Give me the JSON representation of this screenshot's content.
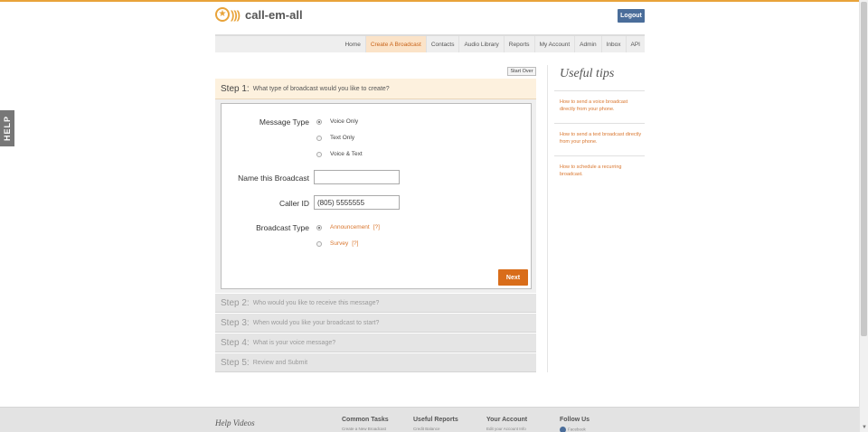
{
  "brand": {
    "name": "call-em-all",
    "logo_glyph": "★"
  },
  "header": {
    "logout_label": "Logout"
  },
  "nav": {
    "items": [
      "Home",
      "Create A Broadcast",
      "Contacts",
      "Audio Library",
      "Reports",
      "My Account",
      "Admin",
      "Inbox",
      "API"
    ],
    "active": "Create A Broadcast"
  },
  "help_tab": "HELP",
  "start_over_label": "Start Over",
  "steps": [
    {
      "num": "Step 1:",
      "desc": "What type of broadcast would you like to create?"
    },
    {
      "num": "Step 2:",
      "desc": "Who would you like to receive this message?"
    },
    {
      "num": "Step 3:",
      "desc": "When would you like your broadcast to start?"
    },
    {
      "num": "Step 4:",
      "desc": "What is your voice message?"
    },
    {
      "num": "Step 5:",
      "desc": "Review and Submit"
    }
  ],
  "form": {
    "message_type_label": "Message Type",
    "message_types": [
      "Voice Only",
      "Text Only",
      "Voice & Text"
    ],
    "selected_message_type": "Voice Only",
    "name_label": "Name this Broadcast",
    "name_value": "",
    "caller_id_label": "Caller ID",
    "caller_id_value": "(805) 5555555",
    "broadcast_type_label": "Broadcast Type",
    "broadcast_types": [
      "Announcement",
      "Survey"
    ],
    "selected_broadcast_type": "Announcement",
    "help_marker": "[?]",
    "next_label": "Next"
  },
  "sidebar": {
    "title": "Useful tips",
    "tips": [
      "How to send a voice broadcast directly from your phone.",
      "How to send a text broadcast directly from your phone.",
      "How to schedule a recurring broadcast."
    ]
  },
  "footer": {
    "help_videos": "Help Videos",
    "columns": [
      {
        "title": "Common Tasks",
        "sub": "Create a New Broadcast"
      },
      {
        "title": "Useful Reports",
        "sub": "Credit Balance"
      },
      {
        "title": "Your Account",
        "sub": "Edit your Account Info"
      },
      {
        "title": "Follow Us",
        "sub": "Facebook"
      }
    ]
  },
  "colors": {
    "accent": "#d96d1a",
    "brand": "#e8a33a",
    "logout": "#4a6d9a"
  }
}
